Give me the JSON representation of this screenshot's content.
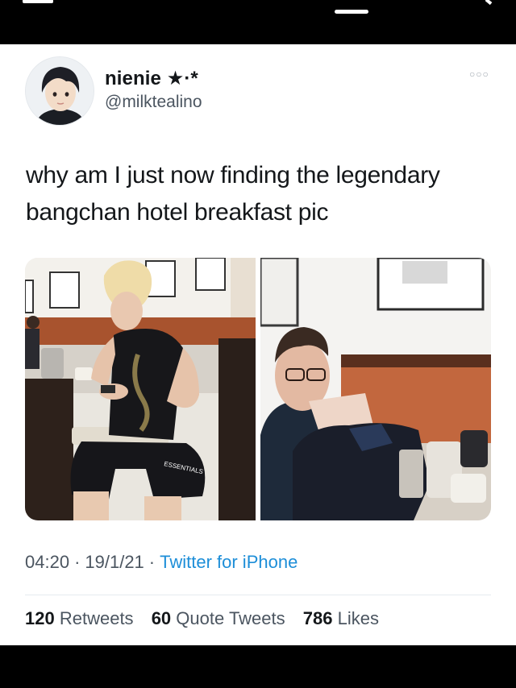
{
  "author": {
    "display_name": "nienie ★·*",
    "handle": "@milktealino"
  },
  "menu_icon": "more-horizontal-icon",
  "tweet": {
    "line1": "why am I just now finding the legendary",
    "line2": "bangchan hotel breakfast pic"
  },
  "photo_text": {
    "shirt_print": "ESSENTIALS"
  },
  "meta": {
    "time": "04:20",
    "date": "19/1/21",
    "separator": "·",
    "source": "Twitter for iPhone"
  },
  "stats": {
    "retweets_count": "120",
    "retweets_label": "Retweets",
    "quotes_count": "60",
    "quotes_label": "Quote Tweets",
    "likes_count": "786",
    "likes_label": "Likes"
  },
  "colors": {
    "link": "#1d8ed8",
    "text": "#14171a",
    "muted": "#4b5560"
  }
}
